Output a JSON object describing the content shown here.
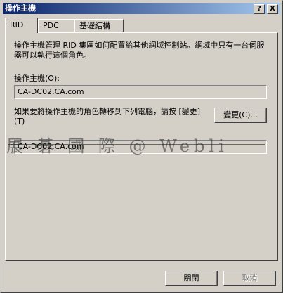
{
  "window": {
    "title": "操作主機",
    "help_button": "?",
    "close_button": "X"
  },
  "tabs": [
    {
      "label": "RID",
      "active": true
    },
    {
      "label": "PDC",
      "active": false
    },
    {
      "label": "基礎結構",
      "active": false
    }
  ],
  "rid_panel": {
    "description": "操作主機管理 RID 集區如何配置給其他網域控制站。網域中只有一台伺服器可以執行這個角色。",
    "operations_master_label": "操作主機(O):",
    "operations_master_value": "CA-DC02.CA.com",
    "transfer_text": "如果要將操作主機的角色轉移到下列電腦，請按 [變更](T)",
    "change_button": "變更(C)...",
    "target_computer_value": "CA-DC02.CA.com"
  },
  "watermark": "展 碁 國 際 @ Webli",
  "footer": {
    "close_button": "關閉",
    "cancel_button": "取消"
  }
}
